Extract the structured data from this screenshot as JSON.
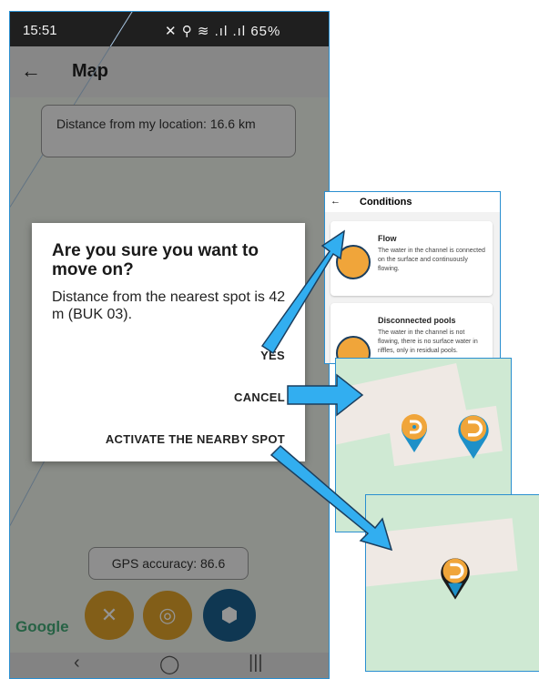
{
  "status_bar": {
    "time": "15:51",
    "icons": "✕ ⚲ ≋ .ıl .ıl",
    "battery": "65%"
  },
  "app_bar": {
    "back_icon": "arrow-left-icon",
    "title": "Map"
  },
  "map": {
    "distance_text": "Distance from my location: 16.6 km",
    "gps_accuracy": "GPS accuracy: 86.6",
    "google_logo": "Google",
    "buttons": [
      "close-icon",
      "location-target-icon",
      "add-location-icon"
    ]
  },
  "dialog": {
    "title": "Are you sure you want to move on?",
    "message": "Distance from the nearest spot is 42 m (BUK 03).",
    "actions": {
      "yes": "YES",
      "cancel": "CANCEL",
      "activate": "ACTIVATE THE NEARBY SPOT"
    }
  },
  "nav_bar": {
    "back": "‹",
    "home": "◯",
    "recents": "|||"
  },
  "conditions_inset": {
    "back_icon": "arrow-left-icon",
    "title": "Conditions",
    "cards": [
      {
        "title": "Flow",
        "description": "The water in the channel is connected on the surface and continuously flowing."
      },
      {
        "title": "Disconnected pools",
        "description": "The water in the channel is not flowing, there is no surface water in riffles, only in residual pools."
      }
    ]
  },
  "colors": {
    "accent_orange": "#e0a32a",
    "pin_blue": "#1e90c8",
    "arrow_blue": "#32aef0",
    "fab_blue": "#1b5f8e"
  }
}
